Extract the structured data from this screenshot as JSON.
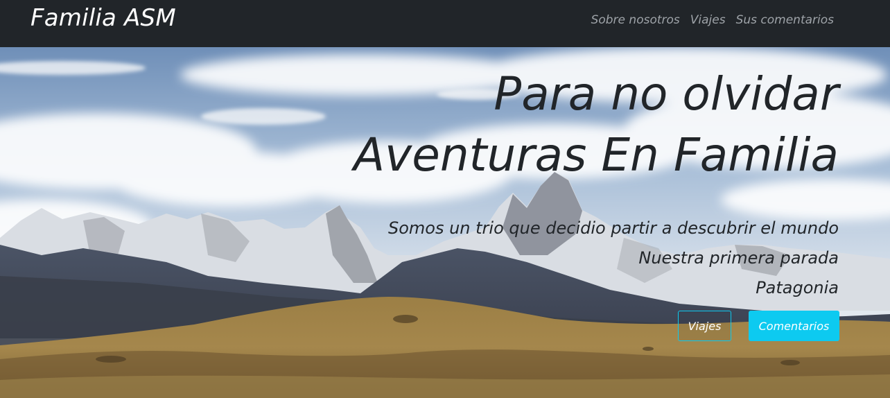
{
  "navbar": {
    "brand": "Familia ASM",
    "links": [
      "Sobre nosotros",
      "Viajes",
      "Sus comentarios"
    ],
    "background": "#212529"
  },
  "hero": {
    "title_line1": "Para no olvidar",
    "title_line2": "Aventuras En Familia",
    "subtitle_lines": [
      "Somos un trio que decidio partir a descubrir el mundo",
      "Nuestra primera parada",
      "Patagonia"
    ],
    "buttons": {
      "outline_label": "Viajes",
      "solid_label": "Comentarios"
    },
    "accent_color": "#0dcaf0",
    "background_image": "mountain-landscape-patagonia"
  }
}
